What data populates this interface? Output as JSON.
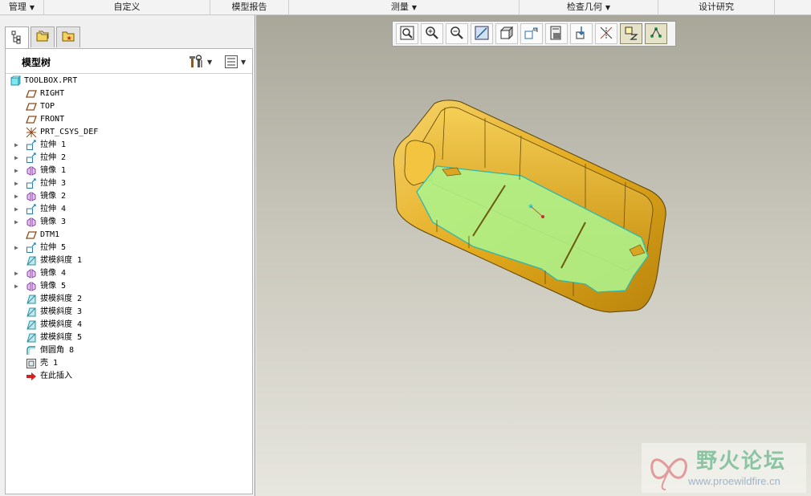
{
  "menubar": {
    "items": [
      {
        "label": "管理",
        "dropdown": true
      },
      {
        "label": "自定义",
        "dropdown": false
      },
      {
        "label": "模型报告",
        "dropdown": false
      },
      {
        "label": "测量",
        "dropdown": true
      },
      {
        "label": "检查几何",
        "dropdown": true
      },
      {
        "label": "设计研究",
        "dropdown": false
      }
    ]
  },
  "left_panel": {
    "tabs": [
      {
        "icon": "model-tree-icon",
        "active": true
      },
      {
        "icon": "folder-browser-icon",
        "active": false
      },
      {
        "icon": "favorites-icon",
        "active": false
      }
    ],
    "tree_title": "模型树",
    "settings_icon": "tools-icon",
    "show_icon": "show-list-icon"
  },
  "model_tree": [
    {
      "label": "TOOLBOX.PRT",
      "icon": "part-icon",
      "expandable": false,
      "level": 0
    },
    {
      "label": "RIGHT",
      "icon": "datum-plane-icon",
      "expandable": false,
      "level": 1
    },
    {
      "label": "TOP",
      "icon": "datum-plane-icon",
      "expandable": false,
      "level": 1
    },
    {
      "label": "FRONT",
      "icon": "datum-plane-icon",
      "expandable": false,
      "level": 1
    },
    {
      "label": "PRT_CSYS_DEF",
      "icon": "csys-icon",
      "expandable": false,
      "level": 1
    },
    {
      "label": "拉伸 1",
      "icon": "extrude-icon",
      "expandable": true,
      "level": 1
    },
    {
      "label": "拉伸 2",
      "icon": "extrude-icon",
      "expandable": true,
      "level": 1
    },
    {
      "label": "镜像 1",
      "icon": "mirror-icon",
      "expandable": true,
      "level": 1
    },
    {
      "label": "拉伸 3",
      "icon": "extrude-icon",
      "expandable": true,
      "level": 1
    },
    {
      "label": "镜像 2",
      "icon": "mirror-icon",
      "expandable": true,
      "level": 1
    },
    {
      "label": "拉伸 4",
      "icon": "extrude-icon",
      "expandable": true,
      "level": 1
    },
    {
      "label": "镜像 3",
      "icon": "mirror-icon",
      "expandable": true,
      "level": 1
    },
    {
      "label": "DTM1",
      "icon": "datum-plane-icon",
      "expandable": false,
      "level": 1
    },
    {
      "label": "拉伸 5",
      "icon": "extrude-icon",
      "expandable": true,
      "level": 1
    },
    {
      "label": "拔模斜度 1",
      "icon": "draft-icon",
      "expandable": false,
      "level": 1
    },
    {
      "label": "镜像 4",
      "icon": "mirror-icon",
      "expandable": true,
      "level": 1
    },
    {
      "label": "镜像 5",
      "icon": "mirror-icon",
      "expandable": true,
      "level": 1
    },
    {
      "label": "拔模斜度 2",
      "icon": "draft-icon",
      "expandable": false,
      "level": 1
    },
    {
      "label": "拔模斜度 3",
      "icon": "draft-icon",
      "expandable": false,
      "level": 1
    },
    {
      "label": "拔模斜度 4",
      "icon": "draft-icon",
      "expandable": false,
      "level": 1
    },
    {
      "label": "拔模斜度 5",
      "icon": "draft-icon",
      "expandable": false,
      "level": 1
    },
    {
      "label": "倒圆角 8",
      "icon": "round-icon",
      "expandable": false,
      "level": 1
    },
    {
      "label": "壳 1",
      "icon": "shell-icon",
      "expandable": false,
      "level": 1
    },
    {
      "label": "在此插入",
      "icon": "insert-here-icon",
      "expandable": false,
      "level": 1
    }
  ],
  "view_toolbar": {
    "buttons": [
      {
        "icon": "zoom-fit-icon",
        "active": false
      },
      {
        "icon": "zoom-in-icon",
        "active": false
      },
      {
        "icon": "zoom-out-icon",
        "active": false
      },
      {
        "icon": "repaint-icon",
        "active": false
      },
      {
        "icon": "saved-orientations-icon",
        "active": false
      },
      {
        "icon": "view-manager-icon",
        "active": false
      },
      {
        "icon": "display-style-icon",
        "active": false
      },
      {
        "icon": "spin-center-icon",
        "active": false
      },
      {
        "icon": "datum-display-icon",
        "active": false
      },
      {
        "icon": "annotation-display-icon",
        "active": true
      },
      {
        "icon": "point-display-icon",
        "active": true
      }
    ]
  },
  "colors": {
    "body_yellow": "#e8b52a",
    "selection_green": "#aef28a",
    "selection_edge": "#2bb8b0",
    "menu_bg": "#f3f3f3"
  },
  "watermark": {
    "title": "野火论坛",
    "url": "www.proewildfire.cn"
  }
}
